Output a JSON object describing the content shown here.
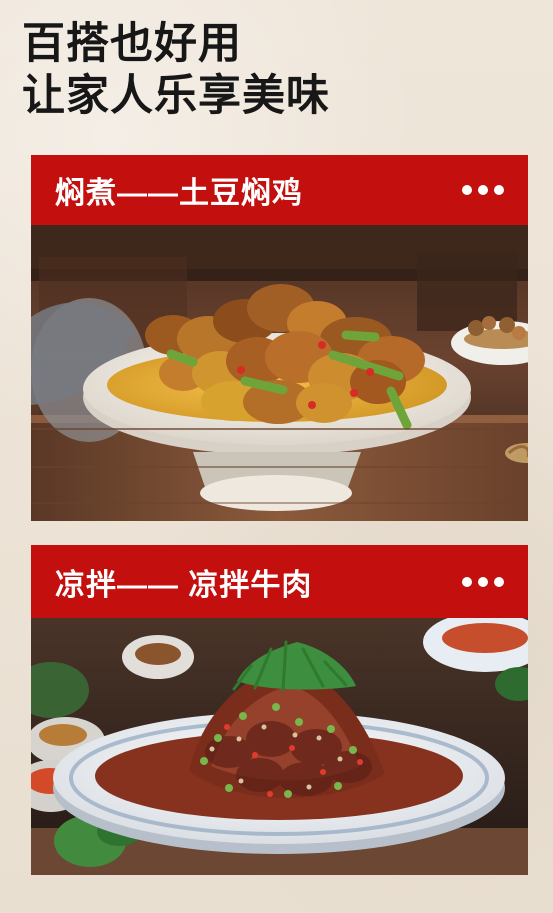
{
  "headline": {
    "line1": "百搭也好用",
    "line2": "让家人乐享美味"
  },
  "cards": [
    {
      "title": "焖煮——土豆焖鸡",
      "menu_icon": "more-horizontal-icon"
    },
    {
      "title": "凉拌—— 凉拌牛肉",
      "menu_icon": "more-horizontal-icon"
    }
  ],
  "colors": {
    "page_background": "#ece2d4",
    "header_red": "#c40f0f",
    "headline_text": "#171717",
    "title_text": "#ffffff"
  }
}
